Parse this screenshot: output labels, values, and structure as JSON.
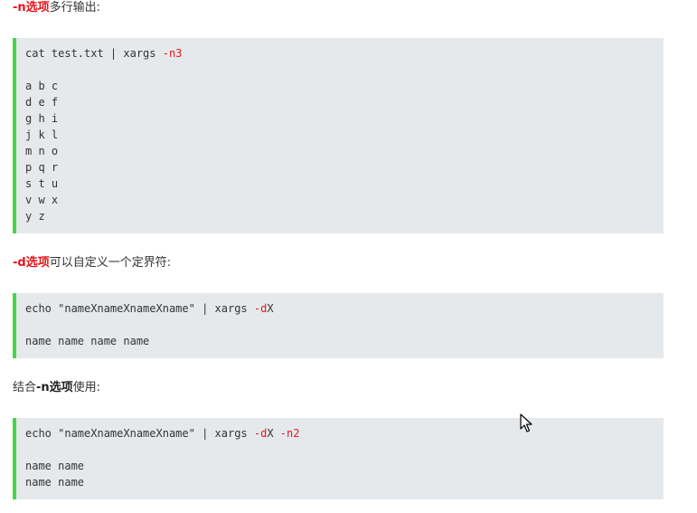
{
  "sections": [
    {
      "intro": {
        "prefix": "",
        "keyword": "-n选项",
        "suffix": "多行输出:"
      },
      "command": {
        "base": "cat test.txt | xargs ",
        "flag1": "-n3",
        "mid": "",
        "flag2": ""
      },
      "output": [
        "a b c",
        "d e f",
        "g h i",
        "j k l",
        "m n o",
        "p q r",
        "s t u",
        "v w x",
        "y z"
      ]
    },
    {
      "intro": {
        "prefix": "",
        "keyword": "-d选项",
        "suffix": "可以自定义一个定界符:"
      },
      "command": {
        "base": "echo \"nameXnameXnameXname\" | xargs ",
        "flag1": "-d",
        "mid": "X",
        "flag2": ""
      },
      "output": [
        "name name name name"
      ]
    },
    {
      "intro": {
        "prefix": "结合",
        "keyword": "-n选项",
        "suffix": "使用:"
      },
      "command": {
        "base": "echo \"nameXnameXnameXname\" | xargs ",
        "flag1": "-d",
        "mid": "X ",
        "flag2": "-n2"
      },
      "output": [
        "name name",
        "name name"
      ]
    }
  ],
  "icons": {
    "cursor": "mouse-pointer-icon"
  },
  "colors": {
    "keyword_red": "#e4161b",
    "code_bg": "#e6e9ec",
    "code_border": "#45d64a",
    "text": "#333333"
  }
}
